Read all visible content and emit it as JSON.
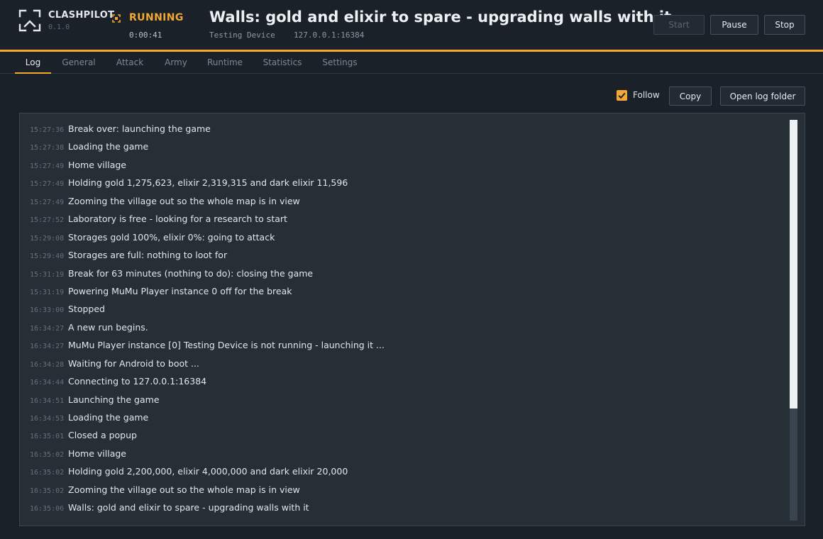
{
  "brand": {
    "name": "CLASHPILOT",
    "version": "0.1.0"
  },
  "status": {
    "label": "RUNNING",
    "elapsed": "0:00:41"
  },
  "title": "Walls: gold and elixir to spare - upgrading walls with it",
  "device": {
    "name": "Testing Device",
    "address": "127.0.0.1:16384"
  },
  "controls": {
    "start": "Start",
    "pause": "Pause",
    "stop": "Stop"
  },
  "tabs": [
    {
      "label": "Log",
      "active": true
    },
    {
      "label": "General"
    },
    {
      "label": "Attack"
    },
    {
      "label": "Army"
    },
    {
      "label": "Runtime"
    },
    {
      "label": "Statistics"
    },
    {
      "label": "Settings"
    }
  ],
  "toolbar": {
    "follow_label": "Follow",
    "follow_checked": true,
    "copy_label": "Copy",
    "open_folder_label": "Open log folder"
  },
  "log": [
    {
      "time": "15:27:36",
      "message": "Break over: launching the game"
    },
    {
      "time": "15:27:38",
      "message": "Loading the game"
    },
    {
      "time": "15:27:49",
      "message": "Home village"
    },
    {
      "time": "15:27:49",
      "message": "Holding gold 1,275,623, elixir 2,319,315 and dark elixir 11,596"
    },
    {
      "time": "15:27:49",
      "message": "Zooming the village out so the whole map is in view"
    },
    {
      "time": "15:27:52",
      "message": "Laboratory is free - looking for a research to start"
    },
    {
      "time": "15:29:08",
      "message": "Storages gold 100%, elixir 0%: going to attack"
    },
    {
      "time": "15:29:40",
      "message": "Storages are full: nothing to loot for"
    },
    {
      "time": "15:31:19",
      "message": "Break for 63 minutes (nothing to do): closing the game"
    },
    {
      "time": "15:31:19",
      "message": "Powering MuMu Player instance 0 off for the break"
    },
    {
      "time": "16:33:00",
      "message": "Stopped"
    },
    {
      "time": "16:34:27",
      "message": "A new run begins."
    },
    {
      "time": "16:34:27",
      "message": "MuMu Player instance [0] Testing Device is not running - launching it ..."
    },
    {
      "time": "16:34:28",
      "message": "Waiting for Android to boot ..."
    },
    {
      "time": "16:34:44",
      "message": "Connecting to 127.0.0.1:16384"
    },
    {
      "time": "16:34:51",
      "message": "Launching the game"
    },
    {
      "time": "16:34:53",
      "message": "Loading the game"
    },
    {
      "time": "16:35:01",
      "message": "Closed a popup"
    },
    {
      "time": "16:35:02",
      "message": "Home village"
    },
    {
      "time": "16:35:02",
      "message": "Holding gold 2,200,000, elixir 4,000,000 and dark elixir 20,000"
    },
    {
      "time": "16:35:02",
      "message": "Zooming the village out so the whole map is in view"
    },
    {
      "time": "16:35:06",
      "message": "Walls: gold and elixir to spare - upgrading walls with it"
    }
  ],
  "colors": {
    "accent": "#f2a833",
    "background": "#1b2129",
    "panel": "#262e36"
  }
}
